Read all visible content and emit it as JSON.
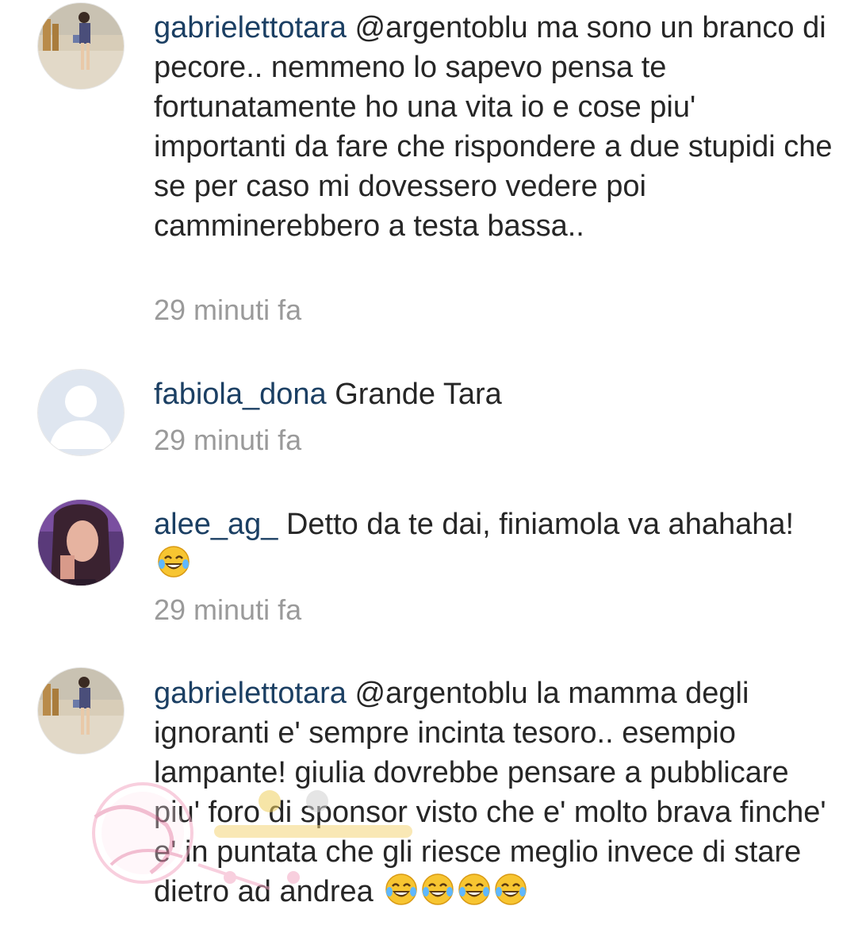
{
  "comments": [
    {
      "username": "gabrielettotara",
      "text": "@argentoblu ma sono un branco di pecore.. nemmeno lo sapevo pensa te fortunatamente ho una vita io e cose piu' importanti da fare che rispondere a due stupidi che se per caso mi dovessero vedere poi camminerebbero a testa bassa..",
      "time": "29 minuti fa",
      "avatar": "photo-avatar"
    },
    {
      "username": "fabiola_dona",
      "text": "Grande Tara",
      "time": "29 minuti fa",
      "avatar": "default-avatar"
    },
    {
      "username": "alee_ag_",
      "text": "Detto da te dai, finiamola va ahahaha!",
      "time": "29 minuti fa",
      "avatar": "photo-avatar",
      "emojis": 1
    },
    {
      "username": "gabrielettotara",
      "text": "@argentoblu la mamma degli ignoranti e' sempre incinta tesoro.. esempio lampante! giulia dovrebbe pensare a pubblicare piu' foro di sponsor visto che e' molto brava finche' e' in puntata che gli riesce meglio invece di stare dietro ad andrea",
      "time": "",
      "avatar": "photo-avatar",
      "emojis": 4
    }
  ],
  "colors": {
    "username": "#1b3f63",
    "text": "#262626",
    "time": "#9a9a9a"
  }
}
